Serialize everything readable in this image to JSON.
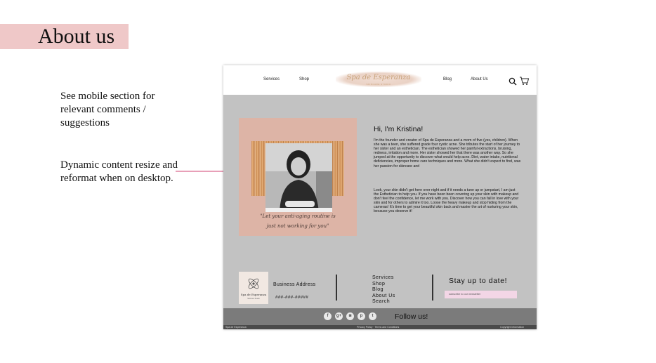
{
  "slide": {
    "title": "About us",
    "note_mobile": "See mobile section for relevant comments / suggestions",
    "note_dynamic": "Dynamic content resize and reformat when on desktop."
  },
  "header": {
    "nav_left": [
      "Services",
      "Shop"
    ],
    "nav_right": [
      "Blog",
      "About Us"
    ],
    "logo_name": "Spa de Esperanza",
    "logo_sub": "SKINCARE STUDIO",
    "search_icon": "search-icon",
    "cart_icon": "shopping-cart-icon"
  },
  "about": {
    "quote_line1": "\"Let your anti-aging routine is",
    "quote_line2": "just not working for you\"",
    "heading": "Hi, I'm Kristina!",
    "paragraph1": "I'm the founder and creator of Spa de Esperanza and a mom of five (yes, children). When she was a teen, she suffered grade four cystic acne.  She tributes the start of her journey to her sister and an esthetician. The esthetician showed her painful extractions, bruising, redness, irritation and more. Her sister showed her that there was another way.  So she jumped at the opportunity to discover what would help acne. Diet, water intake, nutritional deficiencies, improper home care techniques and more.  What she didn't expect to find, was her passion for skincare and",
    "paragraph2": "Look, your skin didn't get here over night and if it needs a tune up or jumpstart, I am just the Esthetician to help you. If you have been been covering up your skin with makeup and don't feel the confidence, let me work with you. Discover how you can fall in love with your skin and for others to admire it too. Loose the heavy makeup and stop hiding from the cameras! It's time to get your beautiful skin back and master the art of nurturing your skin, because you deserve it!"
  },
  "footer": {
    "logo_name": "Spa de Esperanza",
    "logo_sub": "Skincare Studio",
    "business_address": "Business Address",
    "phone": "###-###-#####",
    "links": [
      "Services",
      "Shop",
      "Blog",
      "About Us",
      "Search"
    ],
    "stay_title": "Stay up to date!",
    "newsletter_label": "subscribe to our newsletter",
    "social_icons": [
      {
        "name": "facebook-icon",
        "glyph": "f"
      },
      {
        "name": "google-plus-icon",
        "glyph": "g+"
      },
      {
        "name": "instagram-icon",
        "glyph": "◙"
      },
      {
        "name": "pinterest-icon",
        "glyph": "p"
      },
      {
        "name": "twitter-icon",
        "glyph": "t"
      }
    ],
    "follow_text": "Follow us!",
    "bottom_left": "Spa de Esperanza",
    "bottom_center": "Privacy Policy · Terms and Conditions",
    "bottom_right": "Copyright information"
  },
  "colors": {
    "title_band": "#efc8c8",
    "site_background": "#c2c2c2",
    "photo_panel": "#ddb4a6",
    "newsletter_bg": "#f3d6e6",
    "social_bar": "#7b7b7b",
    "connector": "#e8a0b8"
  }
}
